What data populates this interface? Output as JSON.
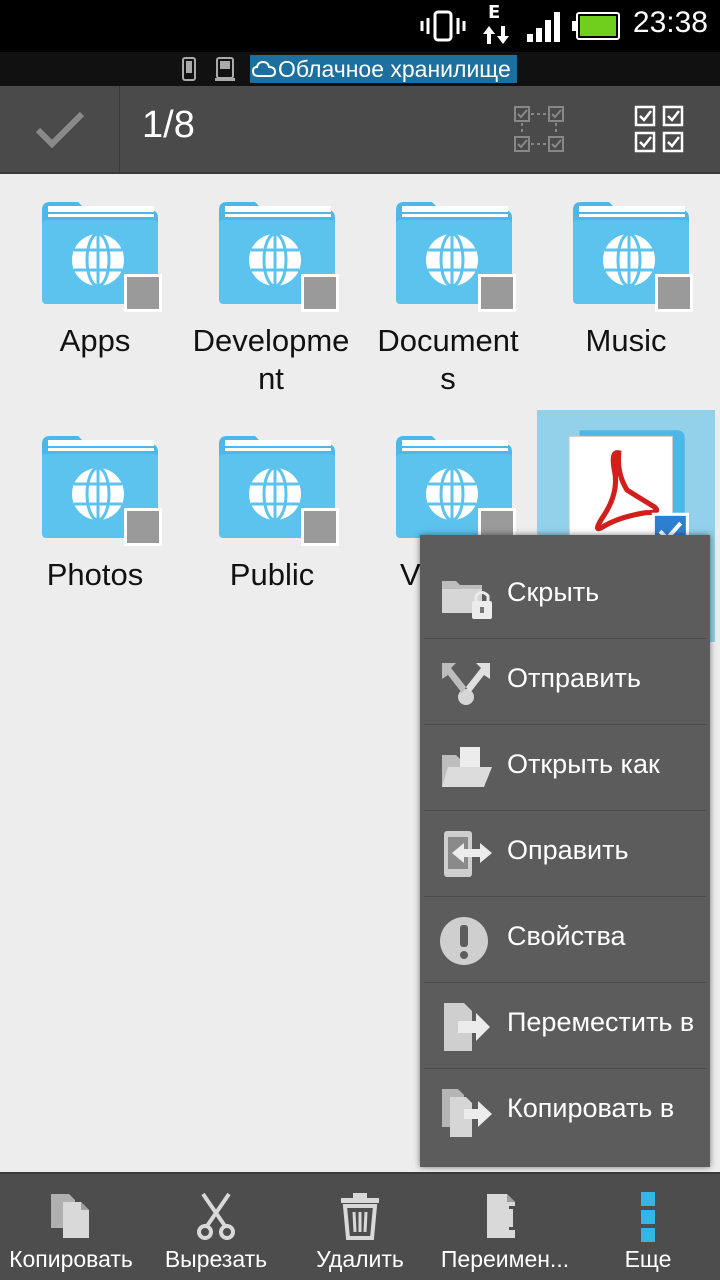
{
  "status_bar": {
    "time": "23:38",
    "network_type": "E",
    "icons": [
      "vibrate-icon",
      "data-transfer-icon",
      "signal-icon",
      "battery-icon"
    ]
  },
  "path_bar": {
    "icons": [
      "phone-storage-icon",
      "sd-storage-icon",
      "cloud-icon"
    ],
    "current": "Облачное хранилище"
  },
  "action_bar": {
    "selection_count": "1/8",
    "icons": [
      "done-check-icon",
      "select-range-icon",
      "select-all-icon"
    ]
  },
  "files": [
    {
      "name": "Apps",
      "type": "folder"
    },
    {
      "name": "Development",
      "type": "folder"
    },
    {
      "name": "Documents",
      "type": "folder"
    },
    {
      "name": "Music",
      "type": "folder"
    },
    {
      "name": "Photos",
      "type": "folder"
    },
    {
      "name": "Public",
      "type": "folder"
    },
    {
      "name": "V",
      "type": "folder"
    },
    {
      "name": "",
      "type": "pdf",
      "selected": true
    }
  ],
  "context_menu": {
    "items": [
      {
        "label": "Скрыть",
        "icon": "hide-folder-lock-icon"
      },
      {
        "label": "Отправить",
        "icon": "share-icon"
      },
      {
        "label": "Открыть как",
        "icon": "open-as-folder-icon"
      },
      {
        "label": "Оправить",
        "icon": "send-to-device-icon"
      },
      {
        "label": "Свойства",
        "icon": "info-exclamation-icon"
      },
      {
        "label": "Переместить в",
        "icon": "move-to-icon"
      },
      {
        "label": "Копировать в",
        "icon": "copy-to-icon"
      }
    ]
  },
  "bottom_bar": {
    "buttons": [
      {
        "label": "Копировать",
        "icon": "copy-icon"
      },
      {
        "label": "Вырезать",
        "icon": "scissors-icon"
      },
      {
        "label": "Удалить",
        "icon": "trash-icon"
      },
      {
        "label": "Переимен...",
        "icon": "rename-icon"
      },
      {
        "label": "Еще",
        "icon": "more-vertical-icon"
      }
    ]
  },
  "colors": {
    "folder": "#4db8e8",
    "selected_tile": "#93d0ea",
    "menu_bg": "#5c5c5c",
    "bar_bg": "#4a4a4a",
    "battery": "#6fcf1c"
  }
}
